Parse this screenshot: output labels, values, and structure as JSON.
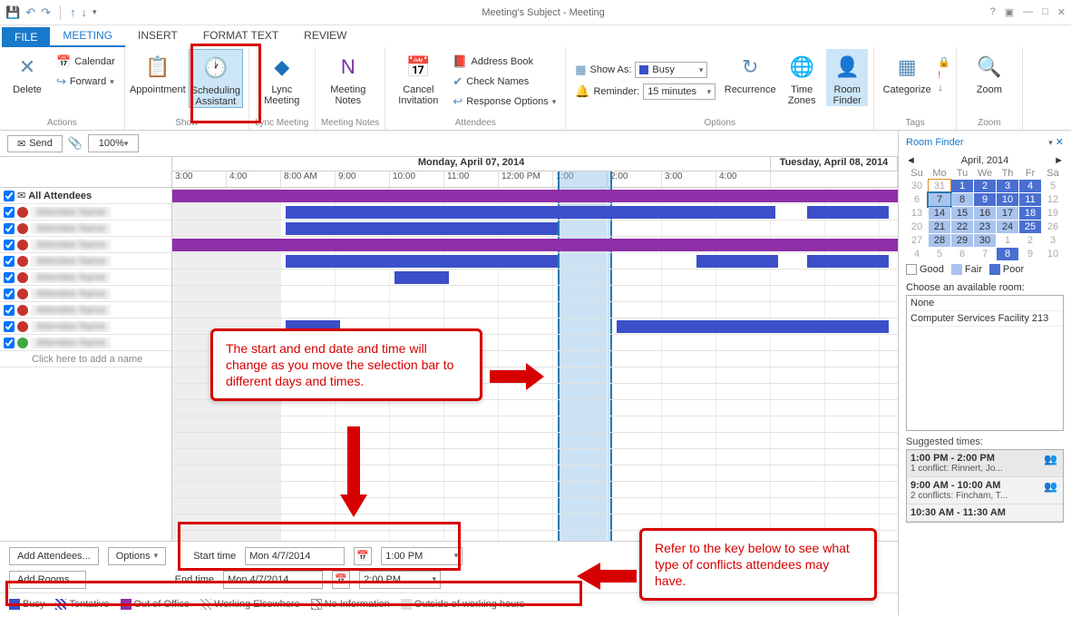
{
  "titlebar": {
    "title": "Meeting's Subject - Meeting"
  },
  "file_tab": "FILE",
  "tabs": [
    "MEETING",
    "INSERT",
    "FORMAT TEXT",
    "REVIEW"
  ],
  "ribbon": {
    "actions": {
      "delete": "Delete",
      "calendar": "Calendar",
      "forward": "Forward",
      "label": "Actions"
    },
    "show": {
      "appointment": "Appointment",
      "scheduling": "Scheduling\nAssistant",
      "label": "Show"
    },
    "lync": {
      "lync": "Lync\nMeeting",
      "label": "Lync Meeting"
    },
    "notes": {
      "notes": "Meeting\nNotes",
      "label": "Meeting Notes"
    },
    "attendees": {
      "cancel": "Cancel\nInvitation",
      "addressbook": "Address Book",
      "checknames": "Check Names",
      "response": "Response Options",
      "label": "Attendees"
    },
    "options": {
      "showas": "Show As:",
      "showas_val": "Busy",
      "reminder": "Reminder:",
      "reminder_val": "15 minutes",
      "recurrence": "Recurrence",
      "timezones": "Time\nZones",
      "roomfinder": "Room\nFinder",
      "label": "Options"
    },
    "tags": {
      "categorize": "Categorize",
      "label": "Tags"
    },
    "zoom": {
      "zoom": "Zoom",
      "label": "Zoom"
    }
  },
  "send": "Send",
  "zoom_level": "100%",
  "schedule": {
    "day1": "Monday, April 07, 2014",
    "day2": "Tuesday, April 08, 2014",
    "times": [
      "3:00",
      "4:00",
      "8:00 AM",
      "9:00",
      "10:00",
      "11:00",
      "12:00 PM",
      "1:00",
      "2:00",
      "3:00",
      "4:00"
    ],
    "all_attendees": "All Attendees",
    "add_name": "Click here to add a name"
  },
  "attendees": [
    {
      "color": "#c4342d"
    },
    {
      "color": "#c4342d"
    },
    {
      "color": "#c4342d"
    },
    {
      "color": "#c4342d"
    },
    {
      "color": "#c4342d"
    },
    {
      "color": "#c4342d"
    },
    {
      "color": "#c4342d"
    },
    {
      "color": "#c4342d"
    },
    {
      "color": "#3fa83f"
    }
  ],
  "bottom": {
    "add_attendees": "Add Attendees...",
    "options": "Options",
    "add_rooms": "Add Rooms...",
    "start": "Start time",
    "start_date": "Mon 4/7/2014",
    "start_time": "1:00 PM",
    "end": "End time",
    "end_date": "Mon 4/7/2014",
    "end_time": "2:00 PM"
  },
  "legend": {
    "busy": "Busy",
    "tentative": "Tentative",
    "oof": "Out of Office",
    "wew": "Working Elsewhere",
    "noinfo": "No Information",
    "outside": "Outside of working hours"
  },
  "roomfinder": {
    "title": "Room Finder",
    "month": "April, 2014",
    "dows": [
      "Su",
      "Mo",
      "Tu",
      "We",
      "Th",
      "Fr",
      "Sa"
    ],
    "good": "Good",
    "fair": "Fair",
    "poor": "Poor",
    "choose": "Choose an available room:",
    "rooms": [
      "None",
      "Computer Services Facility 213"
    ],
    "suggested": "Suggested times:",
    "sugg": [
      {
        "t": "1:00 PM - 2:00 PM",
        "c": "1 conflict: Rinnert, Jo..."
      },
      {
        "t": "9:00 AM - 10:00 AM",
        "c": "2 conflicts: Fincham, T..."
      },
      {
        "t": "10:30 AM - 11:30 AM",
        "c": ""
      }
    ]
  },
  "callouts": {
    "c1": "The start and end date and time will change as  you move the selection bar to different days and times.",
    "c2": "Refer to the key below to see what type of conflicts attendees may have."
  }
}
